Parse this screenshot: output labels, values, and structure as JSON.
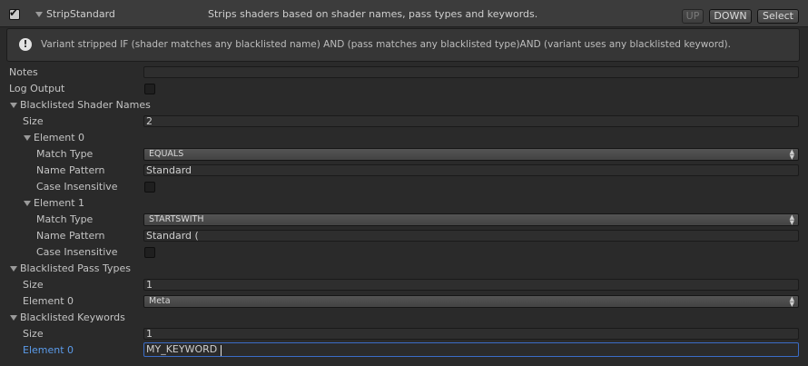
{
  "header": {
    "enabled": true,
    "title": "StripStandard",
    "description": "Strips shaders based on shader names, pass types and keywords.",
    "buttons": {
      "up": "UP",
      "down": "DOWN",
      "select": "Select"
    }
  },
  "help": {
    "icon": "info-icon",
    "text": "Variant stripped IF (shader matches any blacklisted name) AND (pass matches any blacklisted type)AND (variant uses any blacklisted keyword)."
  },
  "properties": {
    "notes": {
      "label": "Notes",
      "value": ""
    },
    "log_output": {
      "label": "Log Output",
      "checked": false
    },
    "shader_names": {
      "label": "Blacklisted Shader Names",
      "size_label": "Size",
      "size": "2",
      "elements": [
        {
          "label": "Element 0",
          "match_type_label": "Match Type",
          "match_type": "EQUALS",
          "name_pattern_label": "Name Pattern",
          "name_pattern": "Standard",
          "case_insensitive_label": "Case Insensitive",
          "case_insensitive": false
        },
        {
          "label": "Element 1",
          "match_type_label": "Match Type",
          "match_type": "STARTSWITH",
          "name_pattern_label": "Name Pattern",
          "name_pattern": "Standard (",
          "case_insensitive_label": "Case Insensitive",
          "case_insensitive": false
        }
      ]
    },
    "pass_types": {
      "label": "Blacklisted Pass Types",
      "size_label": "Size",
      "size": "1",
      "element_label": "Element 0",
      "element_value": "Meta"
    },
    "keywords": {
      "label": "Blacklisted Keywords",
      "size_label": "Size",
      "size": "1",
      "element_label": "Element 0",
      "element_value": "MY_KEYWORD"
    }
  },
  "colors": {
    "accent": "#5b9bea",
    "focus": "#3b6cc6",
    "background": "#2a2a2a"
  }
}
